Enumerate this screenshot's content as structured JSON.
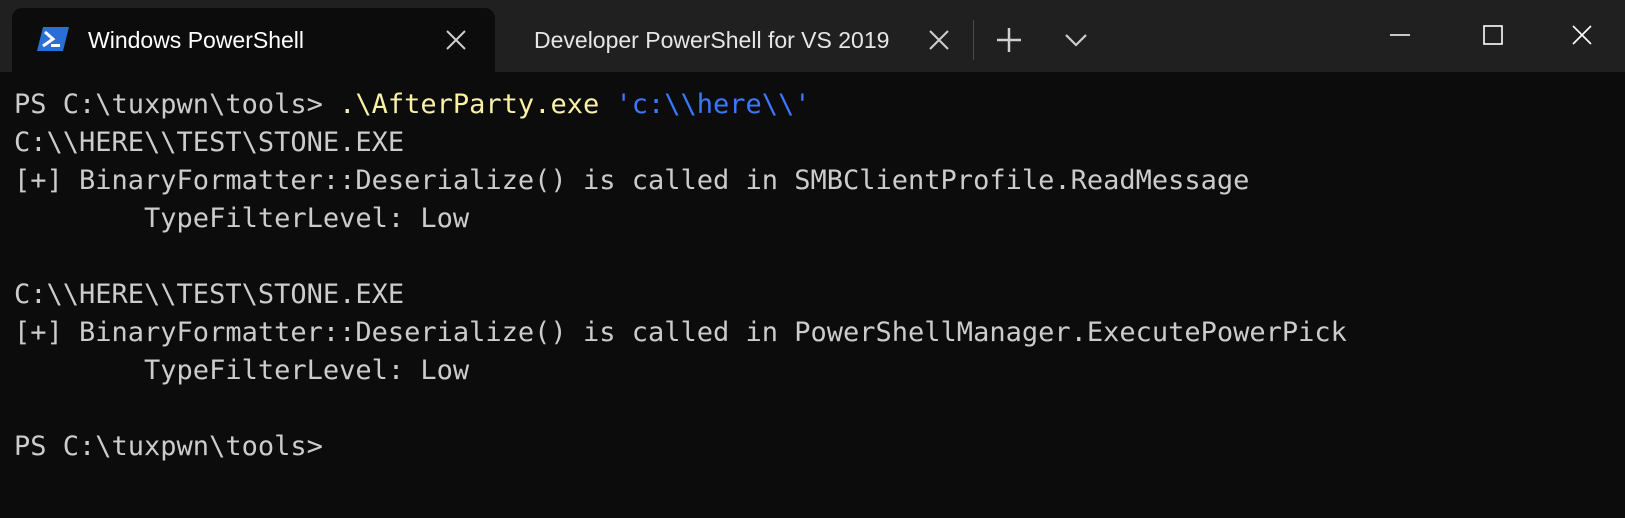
{
  "tabs": [
    {
      "title": "Windows PowerShell",
      "icon": "powershell-icon",
      "active": true
    },
    {
      "title": "Developer PowerShell for VS 2019",
      "active": false
    }
  ],
  "colors": {
    "titlebar": "#202020",
    "terminal_bg": "#0c0c0c",
    "default_text": "#cccccc",
    "command_text": "#f9f1a5",
    "string_text": "#3b78ff",
    "powershell_icon": "#2a6fd6"
  },
  "terminal": {
    "prompt": "PS C:\\tuxpwn\\tools>",
    "command": ".\\AfterParty.exe",
    "argument": "'c:\\\\here\\\\'",
    "output": [
      "C:\\\\HERE\\\\TEST\\STONE.EXE",
      "[+] BinaryFormatter::Deserialize() is called in SMBClientProfile.ReadMessage",
      "        TypeFilterLevel: Low",
      "",
      "C:\\\\HERE\\\\TEST\\STONE.EXE",
      "[+] BinaryFormatter::Deserialize() is called in PowerShellManager.ExecutePowerPick",
      "        TypeFilterLevel: Low",
      ""
    ],
    "final_prompt": "PS C:\\tuxpwn\\tools>"
  }
}
